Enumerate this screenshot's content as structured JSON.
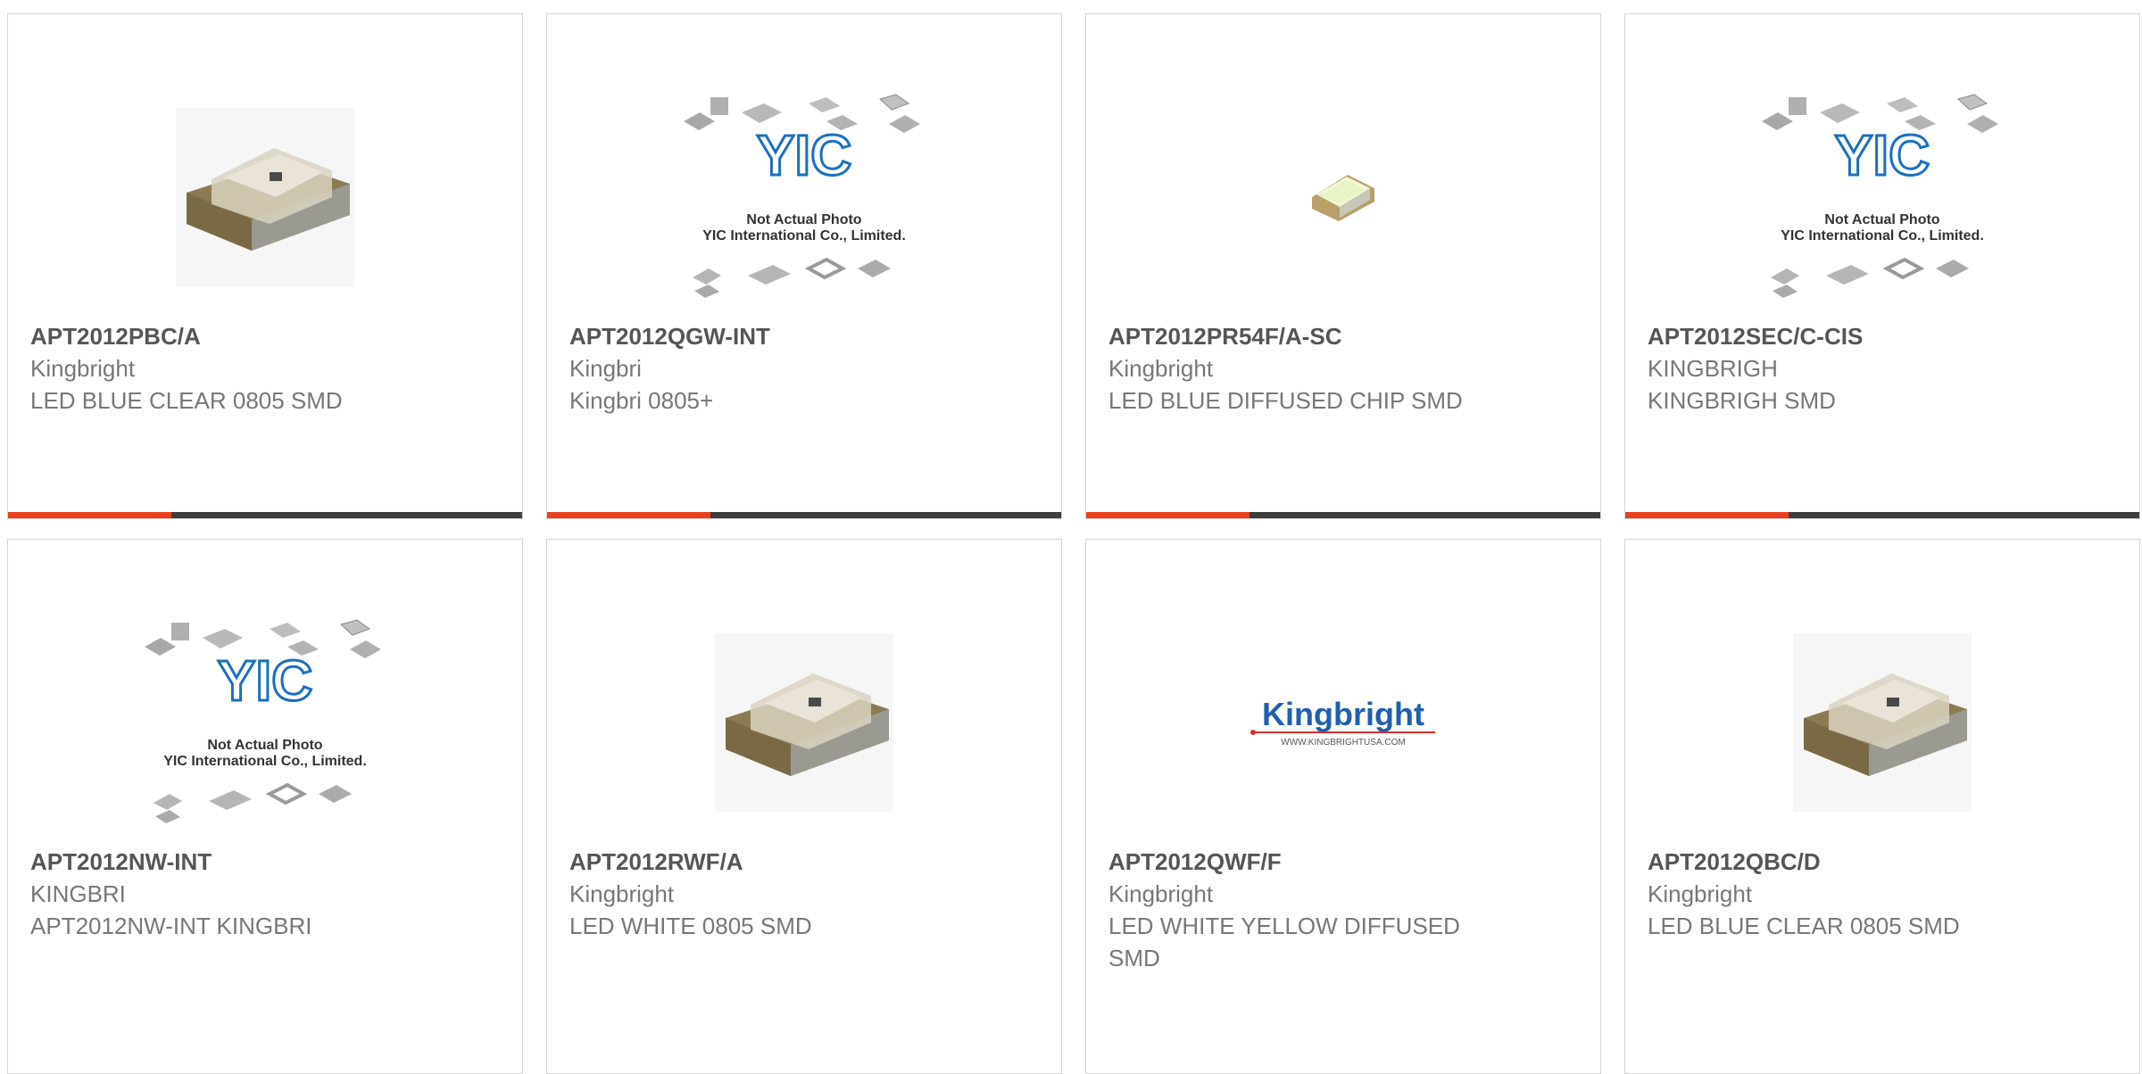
{
  "products": [
    {
      "part": "APT2012PBC/A",
      "manufacturer": "Kingbright",
      "description": "LED BLUE CLEAR 0805 SMD",
      "image": "led-chip-photo",
      "image_caption": []
    },
    {
      "part": "APT2012QGW-INT",
      "manufacturer": "Kingbri",
      "description": "Kingbri 0805+",
      "image": "yic-placeholder",
      "image_caption": [
        "Not Actual Photo",
        "YIC International Co., Limited."
      ]
    },
    {
      "part": "APT2012PR54F/A-SC",
      "manufacturer": "Kingbright",
      "description": "LED BLUE DIFFUSED CHIP SMD",
      "image": "small-led-photo",
      "image_caption": []
    },
    {
      "part": "APT2012SEC/C-CIS",
      "manufacturer": "KINGBRIGH",
      "description": "KINGBRIGH SMD",
      "image": "yic-placeholder",
      "image_caption": [
        "Not Actual Photo",
        "YIC International Co., Limited."
      ]
    },
    {
      "part": "APT2012NW-INT",
      "manufacturer": "KINGBRI",
      "description": "APT2012NW-INT KINGBRI",
      "image": "yic-placeholder",
      "image_caption": [
        "Not Actual Photo",
        "YIC International Co., Limited."
      ]
    },
    {
      "part": "APT2012RWF/A",
      "manufacturer": "Kingbright",
      "description": "LED WHITE 0805 SMD",
      "image": "led-chip-photo",
      "image_caption": []
    },
    {
      "part": "APT2012QWF/F",
      "manufacturer": "Kingbright",
      "description": "LED WHITE YELLOW DIFFUSED SMD",
      "image": "kingbright-logo",
      "image_caption": [],
      "logo_text": "Kingbright",
      "logo_url": "WWW.KINGBRIGHTUSA.COM"
    },
    {
      "part": "APT2012QBC/D",
      "manufacturer": "Kingbright",
      "description": "LED BLUE CLEAR 0805 SMD",
      "image": "led-chip-photo",
      "image_caption": []
    }
  ],
  "colors": {
    "accent": "#e8401c",
    "bar": "#3d3d3d",
    "border": "#d5d5d5",
    "part_text": "#555555",
    "body_text": "#777777",
    "yic_blue": "#1a6fbf"
  }
}
